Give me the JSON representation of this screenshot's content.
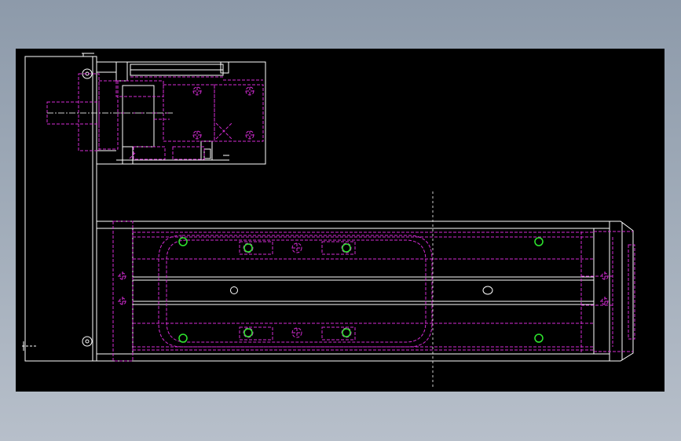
{
  "colors": {
    "outline": "#ffffff",
    "hidden": "#d42bd4",
    "hole": "#2ee82e",
    "background": "#000000",
    "centerline": "#cccccc"
  },
  "icons": {
    "pilot_hole": "green-circle-icon",
    "bolt_hole": "crosshair-circle-icon"
  }
}
